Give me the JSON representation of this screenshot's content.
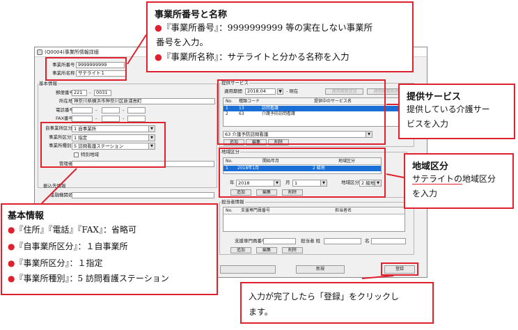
{
  "window": {
    "title": "(Q0004)事業所情報詳細"
  },
  "office": {
    "number_label": "事業所番号",
    "number_value": "9999999999",
    "name_label": "事業所名称",
    "name_value": "サテライト１"
  },
  "basic": {
    "group_title": "基本情報",
    "postal_label": "郵便番号",
    "postal_1": "221",
    "postal_sep": "-",
    "postal_2": "0031",
    "address_label": "所在地",
    "address_value": "神奈川県横浜市神奈川区新浦島町",
    "phone_label": "電話番号",
    "fax_label": "FAX番号",
    "dash": "-",
    "own_category_label": "自事業所区分",
    "own_category_value": "1 自事業所",
    "office_category_label": "事業所区分",
    "office_category_value": "1 指定",
    "office_type_label": "事業所種別",
    "office_type_value": "5 訪問看護ステーション",
    "special_region_label": "特別地域",
    "manager_label": "管理者"
  },
  "transfer": {
    "group_title": "振込先情報",
    "bank_label": "金融機関名"
  },
  "services": {
    "group_title": "提供サービス",
    "period_label": "適用期間",
    "period_value": "2018.04",
    "period_suffix": "- 現在",
    "add_period_btn": "適用期間追加",
    "delete_period_btn": "適用期間削除",
    "col_no": "No.",
    "col_code": "種類コード",
    "col_name": "提供中のサービス名",
    "rows": [
      {
        "no": "1",
        "code": "13",
        "name": "訪問看護"
      },
      {
        "no": "2",
        "code": "63",
        "name": "介護予防訪問看護"
      }
    ],
    "select_value": "63 介護予防訪問看護",
    "add_btn": "追加",
    "edit_btn": "編集",
    "delete_btn": "削除"
  },
  "region": {
    "group_title": "地域区分",
    "col_no": "No.",
    "col_start": "開始年月",
    "col_region": "地域区分",
    "rows": [
      {
        "no": "1",
        "start": "2018年1月",
        "region": "2 級地"
      }
    ],
    "year_label": "年",
    "year_value": "2018",
    "month_label": "月",
    "month_value": "1",
    "region_label": "地域区分",
    "region_value": "2 級地",
    "add_btn": "追加",
    "edit_btn": "編集",
    "delete_btn": "削除"
  },
  "staff": {
    "group_title": "担当者情報",
    "col_no": "No.",
    "col_support_no": "支援専門員番号",
    "col_name": "担当者名",
    "support_no_label": "支援専門員番号",
    "last_name_label": "担当者 姓",
    "first_name_label": "名",
    "add_btn": "追加",
    "edit_btn": "編集",
    "delete_btn": "削除"
  },
  "footer": {
    "new_btn": "新規",
    "register_btn": "登録"
  },
  "callouts": {
    "office": {
      "title": "事業所番号と名称",
      "line1": "『事業所番号』：9999999999 等の実在しない事業所",
      "line2": "番号を入力。",
      "line3": "『事業所名称』：サテライトと分かる名称を入力"
    },
    "services": {
      "title": "提供サービス",
      "line1": "提供している介護サー",
      "line2": "ビスを入力"
    },
    "region": {
      "title": "地域区分",
      "line1a": "サテライトの",
      "line1b": "地域区分",
      "line2": "を入力"
    },
    "basic": {
      "title": "基本情報",
      "line1": "『住所』『電話』『FAX』：省略可",
      "line2": "『自事業所区分』：１自事業所",
      "line3": "『事業所区分』：１指定",
      "line4": "『事業所種別』：5 訪問看護ステーション"
    },
    "register": {
      "line1": "入力が完了したら「登録」をクリックし",
      "line2": "ます。"
    },
    "bullet": "●"
  },
  "colors": {
    "callout_red": "#e0202d",
    "selection_blue": "#1a6fd6"
  }
}
